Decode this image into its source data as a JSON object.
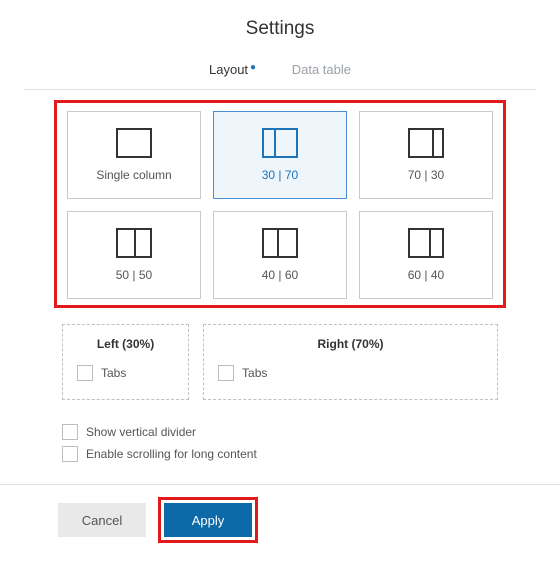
{
  "title": "Settings",
  "tabs": {
    "layout": "Layout",
    "data_table": "Data table"
  },
  "layout_options": [
    {
      "label": "Single column",
      "split": null
    },
    {
      "label": "30 | 70",
      "split": 30
    },
    {
      "label": "70 | 30",
      "split": 70
    },
    {
      "label": "50 | 50",
      "split": 50
    },
    {
      "label": "40 | 60",
      "split": 40
    },
    {
      "label": "60 | 40",
      "split": 60
    }
  ],
  "selected_index": 1,
  "panels": {
    "left": {
      "title": "Left (30%)",
      "tabs_label": "Tabs"
    },
    "right": {
      "title": "Right (70%)",
      "tabs_label": "Tabs"
    }
  },
  "options": {
    "show_divider": "Show vertical divider",
    "enable_scroll": "Enable scrolling for long content"
  },
  "buttons": {
    "cancel": "Cancel",
    "apply": "Apply"
  },
  "highlights": {
    "grid": true,
    "apply_button": true
  }
}
